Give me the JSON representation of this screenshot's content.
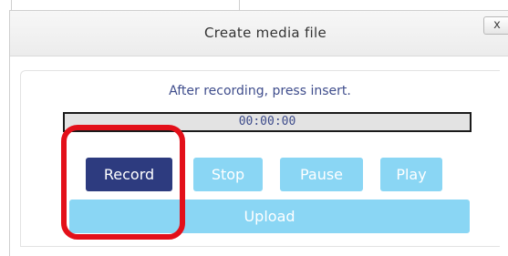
{
  "dialog": {
    "title": "Create media file",
    "close_label": "x"
  },
  "recorder": {
    "instruction": "After recording, press insert.",
    "timer": "00:00:00",
    "buttons": {
      "record": "Record",
      "stop": "Stop",
      "pause": "Pause",
      "play": "Play",
      "upload": "Upload"
    }
  },
  "colors": {
    "primary_button": "#2d3b7f",
    "secondary_button": "#8ad6f4",
    "highlight": "#e3101a",
    "text_accent": "#3f4d8c"
  }
}
